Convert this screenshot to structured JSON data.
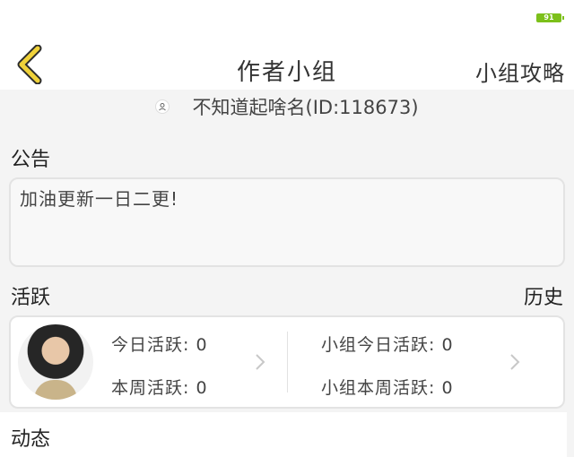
{
  "status_bar": {
    "battery": "91",
    "battery_color": "#7cc01a"
  },
  "header": {
    "back_icon": "chevron-left-icon",
    "back_color": "#f0d23a",
    "title": "作者小组",
    "right_link": "小组攻略"
  },
  "leader": {
    "icon": "person-icon",
    "text": "不知道起啥名(ID:118673)"
  },
  "notice": {
    "label": "公告",
    "content": "加油更新一日二更!"
  },
  "activity": {
    "label": "活跃",
    "history_link": "历史",
    "avatar": "avatar-photo",
    "today": "今日活跃: 0",
    "week": "本周活跃: 0",
    "group_today": "小组今日活跃: 0",
    "group_week": "小组本周活跃: 0"
  },
  "dynamic": {
    "label": "动态"
  }
}
